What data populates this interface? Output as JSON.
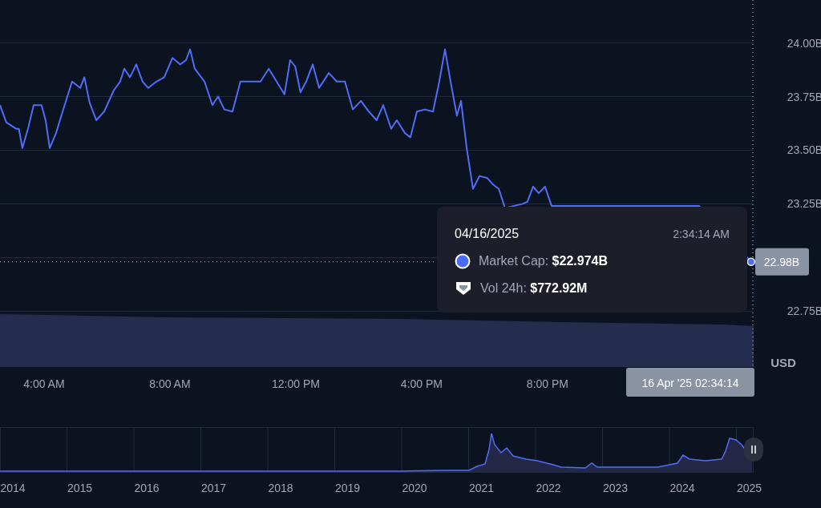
{
  "chart": {
    "chart_data": {
      "type": "line",
      "series": [
        {
          "color": "#4f6ef7",
          "values": [
            23.71,
            23.63,
            23.6,
            23.6,
            23.51,
            23.6,
            23.71,
            23.71,
            23.64,
            23.51,
            23.58,
            23.68,
            23.82,
            23.79,
            23.84,
            23.72,
            23.64,
            23.68,
            23.78,
            23.82,
            23.88,
            23.84,
            23.9,
            23.82,
            23.79,
            23.82,
            23.84,
            23.93,
            23.9,
            23.92,
            23.97,
            23.88,
            23.82,
            23.71,
            23.75,
            23.69,
            23.68,
            23.82,
            23.82,
            23.82,
            23.88,
            23.82,
            23.76,
            23.92,
            23.89,
            23.77,
            23.82,
            23.9,
            23.79,
            23.86,
            23.82,
            23.82,
            23.69,
            23.73,
            23.68,
            23.64,
            23.71,
            23.6,
            23.64,
            23.58,
            23.56,
            23.68,
            23.69,
            23.68,
            23.82,
            23.97,
            23.82,
            23.66,
            23.73,
            23.51,
            23.32,
            23.38,
            23.37,
            23.34,
            23.32,
            23.23,
            23.25,
            23.26,
            23.33,
            23.3,
            23.33,
            23.24,
            23.24,
            22.98
          ]
        }
      ],
      "grid": true,
      "ref_lines": [
        {
          "axis": "y",
          "value": 22.98
        },
        {
          "axis": "x",
          "value": 26.55
        }
      ],
      "x": [
        2.6,
        2.8,
        3.11,
        3.2,
        3.31,
        3.49,
        3.67,
        3.92,
        4.05,
        4.18,
        4.38,
        4.59,
        4.89,
        5.15,
        5.28,
        5.45,
        5.66,
        5.91,
        6.22,
        6.42,
        6.55,
        6.73,
        6.93,
        7.13,
        7.31,
        7.57,
        7.82,
        8.08,
        8.33,
        8.51,
        8.64,
        8.79,
        9.1,
        9.35,
        9.53,
        9.73,
        9.99,
        10.24,
        10.63,
        10.88,
        11.14,
        11.39,
        11.64,
        11.82,
        11.98,
        12.15,
        12.33,
        12.54,
        12.74,
        13.05,
        13.3,
        13.56,
        13.81,
        14.07,
        14.32,
        14.57,
        14.78,
        15.03,
        15.21,
        15.47,
        15.64,
        15.85,
        16.1,
        16.36,
        16.56,
        16.74,
        16.92,
        17.12,
        17.25,
        17.43,
        17.63,
        17.84,
        18.09,
        18.27,
        18.45,
        18.65,
        19.21,
        19.36,
        19.54,
        19.72,
        19.92,
        20.13,
        24.82,
        26.47
      ],
      "xlim": [
        2.6,
        26.55
      ],
      "ylim": [
        22.49,
        24.2
      ],
      "xticks": [
        {
          "value": 4,
          "label": "4:00 AM"
        },
        {
          "value": 8,
          "label": "8:00 AM"
        },
        {
          "value": 12,
          "label": "12:00 PM"
        },
        {
          "value": 16,
          "label": "4:00 PM"
        },
        {
          "value": 20,
          "label": "8:00 PM"
        }
      ],
      "yticks": [
        {
          "value": 22.75,
          "label": "22.75B"
        },
        {
          "value": 23.25,
          "label": "23.25B"
        },
        {
          "value": 23.5,
          "label": "23.50B"
        },
        {
          "value": 23.75,
          "label": "23.75B"
        },
        {
          "value": 24,
          "label": "24.00B"
        }
      ]
    }
  },
  "axis_unit": "USD",
  "crosshair": {
    "price_label": "22.98B",
    "time_label": "16 Apr '25 02:34:14"
  },
  "tooltip": {
    "date": "04/16/2025",
    "time": "2:34:14 AM",
    "rows": [
      {
        "kind": "market_cap",
        "label": "Market Cap:",
        "value": "$22.974B"
      },
      {
        "kind": "volume",
        "label": "Vol 24h:",
        "value": "$772.92M"
      }
    ]
  },
  "navigator": {
    "years": [
      "2014",
      "2015",
      "2016",
      "2017",
      "2018",
      "2019",
      "2020",
      "2021",
      "2022",
      "2023",
      "2024",
      "2025"
    ]
  }
}
